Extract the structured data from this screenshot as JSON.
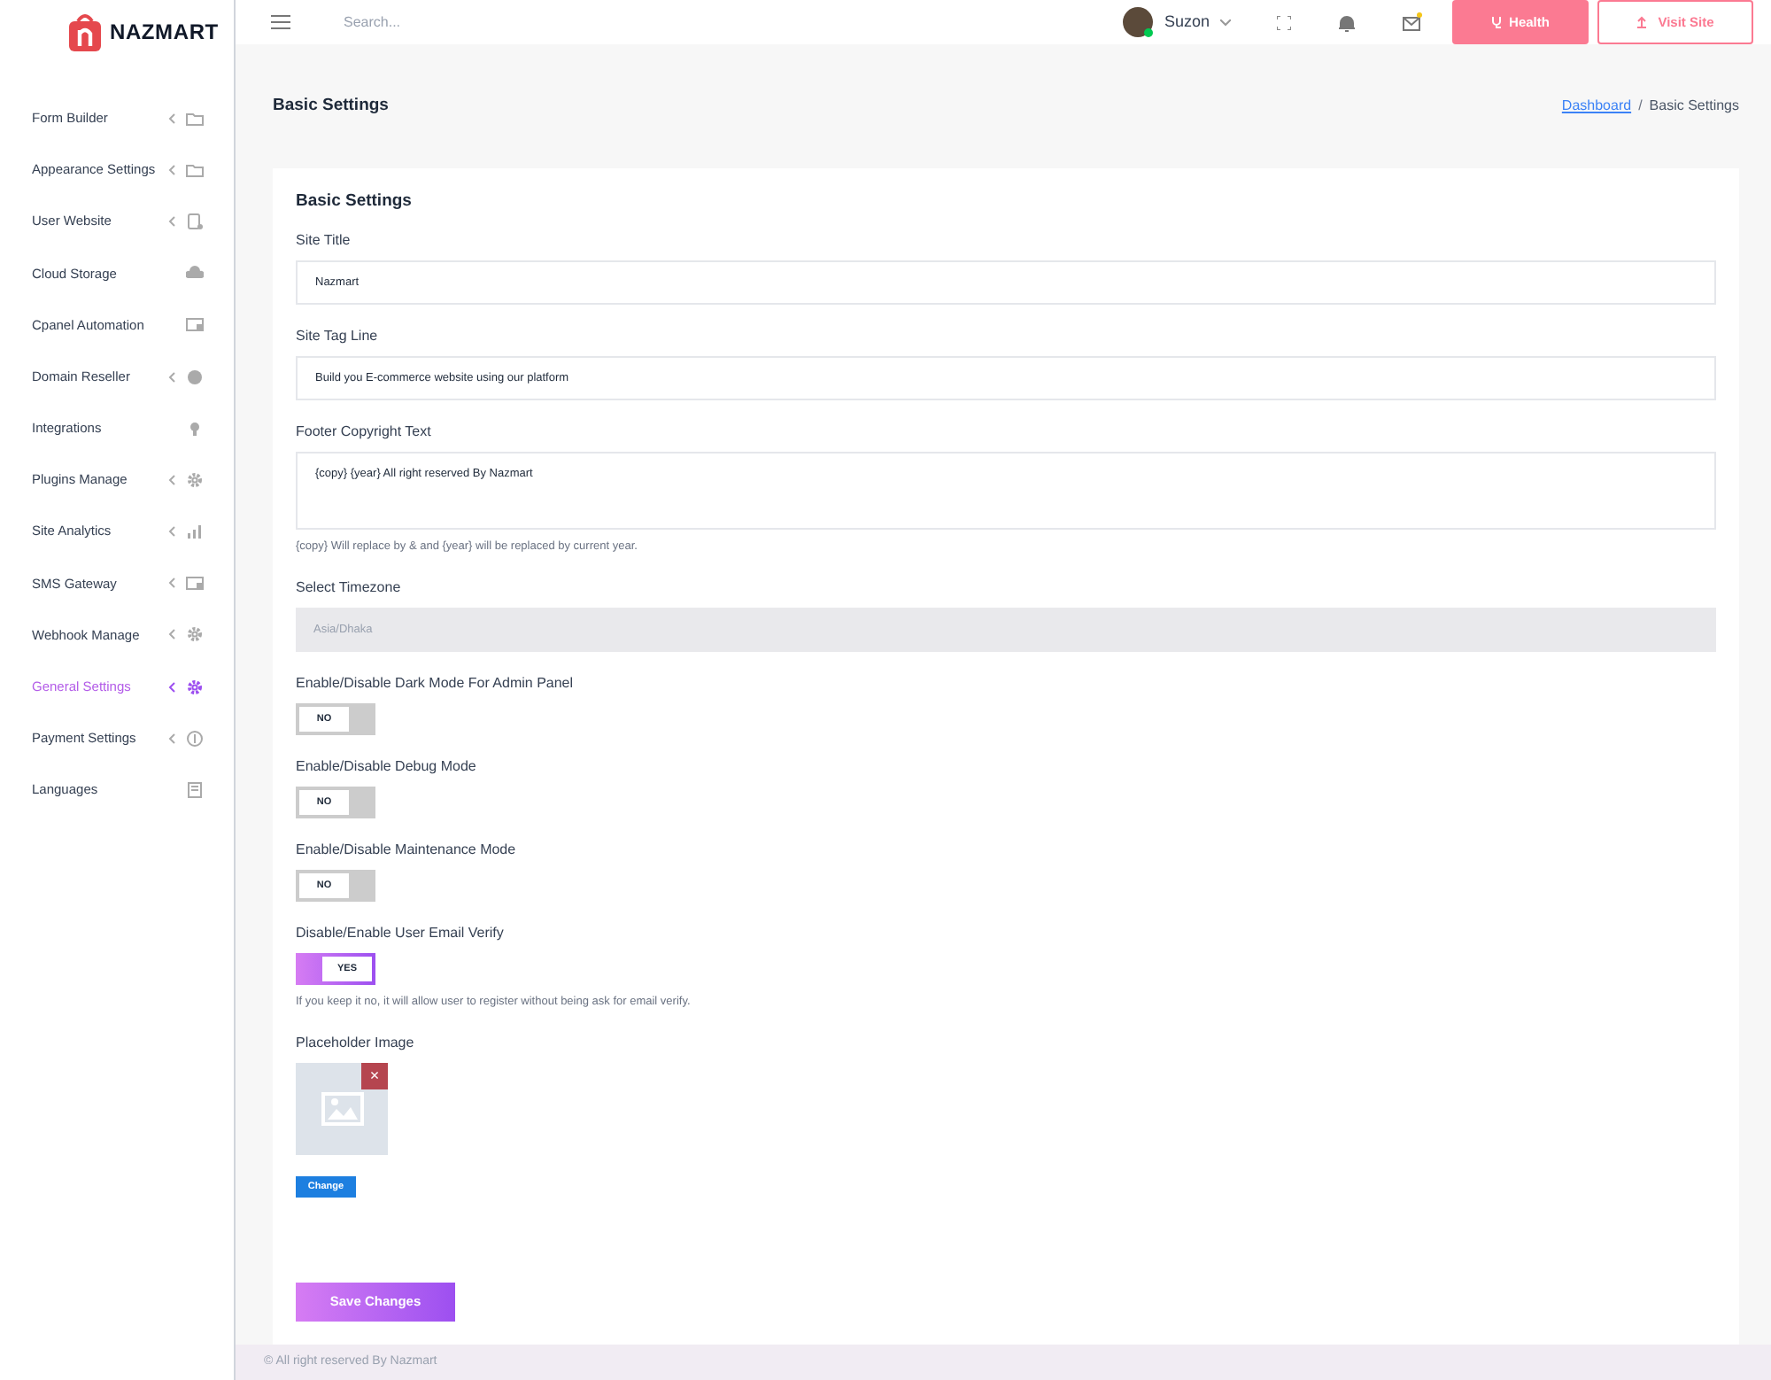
{
  "brand": "NAZMART",
  "search": {
    "placeholder": "Search..."
  },
  "user": {
    "name": "Suzon"
  },
  "header_buttons": [
    {
      "kind": "health",
      "label": "Health"
    },
    {
      "kind": "visit",
      "label": "Visit Site"
    }
  ],
  "sidebar": {
    "items": [
      {
        "label": "Form Builder",
        "has_children": true,
        "selected": false
      },
      {
        "label": "Appearance Settings",
        "has_children": true,
        "selected": false
      },
      {
        "label": "User Website",
        "has_children": true,
        "selected": false
      },
      {
        "label": "Cloud Storage",
        "has_children": false,
        "selected": false
      },
      {
        "label": "Cpanel Automation",
        "has_children": false,
        "selected": false
      },
      {
        "label": "Domain Reseller",
        "has_children": true,
        "selected": false
      },
      {
        "label": "Integrations",
        "has_children": false,
        "selected": false
      },
      {
        "label": "Plugins Manage",
        "has_children": true,
        "selected": false
      },
      {
        "label": "Site Analytics",
        "has_children": true,
        "selected": false
      },
      {
        "label": "SMS Gateway",
        "has_children": true,
        "selected": false
      },
      {
        "label": "Webhook Manage",
        "has_children": true,
        "selected": false
      },
      {
        "label": "General Settings",
        "has_children": true,
        "selected": true
      },
      {
        "label": "Payment Settings",
        "has_children": true,
        "selected": false
      },
      {
        "label": "Languages",
        "has_children": false,
        "selected": false
      }
    ]
  },
  "page_title": "Basic Settings",
  "breadcrumb": [
    {
      "label": "Dashboard",
      "kind": "link"
    },
    {
      "label": "/",
      "kind": "sep"
    },
    {
      "label": "Basic Settings",
      "kind": "text"
    }
  ],
  "card": {
    "title": "Basic Settings",
    "fields": [
      {
        "kind": "text",
        "label": "Site Title",
        "value": "Nazmart"
      },
      {
        "kind": "text",
        "label": "Site Tag Line",
        "value": "Build you E-commerce website using our platform"
      },
      {
        "kind": "textarea",
        "label": "Footer Copyright Text",
        "value": "{copy} {year} All right reserved By Nazmart",
        "help": "{copy} Will replace by & and {year} will be replaced by current year."
      },
      {
        "kind": "select",
        "label": "Select Timezone",
        "value": "Asia/Dhaka"
      },
      {
        "kind": "switch",
        "label": "Enable/Disable Dark Mode For Admin Panel",
        "on": false,
        "state_text": "NO"
      },
      {
        "kind": "switch",
        "label": "Enable/Disable Debug Mode",
        "on": false,
        "state_text": "NO"
      },
      {
        "kind": "switch",
        "label": "Enable/Disable Maintenance Mode",
        "on": false,
        "state_text": "NO"
      },
      {
        "kind": "switch",
        "label": "Disable/Enable User Email Verify",
        "on": true,
        "state_text": "YES",
        "help": "If you keep it no, it will allow user to register without being ask for email verify."
      },
      {
        "kind": "image",
        "label": "Placeholder Image",
        "button": "Change",
        "remove": "×"
      }
    ],
    "submit": "Save Changes"
  },
  "footer": "© All right reserved By Nazmart"
}
